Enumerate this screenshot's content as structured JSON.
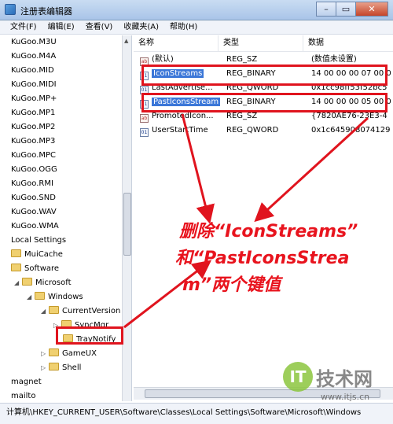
{
  "window": {
    "title": "注册表编辑器",
    "btn_minimize": "–",
    "btn_maximize": "▭",
    "btn_close": "✕"
  },
  "menu": [
    "文件(F)",
    "编辑(E)",
    "查看(V)",
    "收藏夹(A)",
    "帮助(H)"
  ],
  "tree": {
    "ext_items": [
      "KuGoo.M3U",
      "KuGoo.M4A",
      "KuGoo.MID",
      "KuGoo.MIDI",
      "KuGoo.MP+",
      "KuGoo.MP1",
      "KuGoo.MP2",
      "KuGoo.MP3",
      "KuGoo.MPC",
      "KuGoo.OGG",
      "KuGoo.RMI",
      "KuGoo.SND",
      "KuGoo.WAV",
      "KuGoo.WMA"
    ],
    "local_settings": "Local Settings",
    "muicache": "MuiCache",
    "software": "Software",
    "microsoft": "Microsoft",
    "windows": "Windows",
    "current_version": "CurrentVersion",
    "syncmgr": "SyncMgr",
    "traynotify": "TrayNotify",
    "gameux": "GameUX",
    "shell": "Shell",
    "magnet": "magnet",
    "mailto": "mailto"
  },
  "list": {
    "headers": [
      "名称",
      "类型",
      "数据"
    ],
    "rows": [
      {
        "name": "(默认)",
        "type": "REG_SZ",
        "data": "(数值未设置)",
        "icon": "string-value-icon"
      },
      {
        "name": "IconStreams",
        "type": "REG_BINARY",
        "data": "14 00 00 00 07 00 0",
        "icon": "binary-value-icon"
      },
      {
        "name": "LastAdvertise...",
        "type": "REG_QWORD",
        "data": "0x1cc98ff53f52bc5",
        "icon": "binary-value-icon"
      },
      {
        "name": "PastIconsStream",
        "type": "REG_BINARY",
        "data": "14 00 00 00 05 00 0",
        "icon": "binary-value-icon"
      },
      {
        "name": "PromotedIcon...",
        "type": "REG_SZ",
        "data": "{7820AE76-23E3-4",
        "icon": "string-value-icon"
      },
      {
        "name": "UserStartTime",
        "type": "REG_QWORD",
        "data": "0x1c645908074129",
        "icon": "binary-value-icon"
      }
    ]
  },
  "status_path": "计算机\\HKEY_CURRENT_USER\\Software\\Classes\\Local Settings\\Software\\Microsoft\\Windows",
  "annotation": {
    "line1": "删除“IconStreams”",
    "line2": "和“PastIconsStrea",
    "line3": "m”两个键值"
  },
  "watermark": {
    "logo_glyph": "IT",
    "name": "技术网",
    "url": "www.itjs.cn"
  },
  "colors": {
    "annotation_red": "#e0141e",
    "selection_blue": "#3b77d8"
  }
}
